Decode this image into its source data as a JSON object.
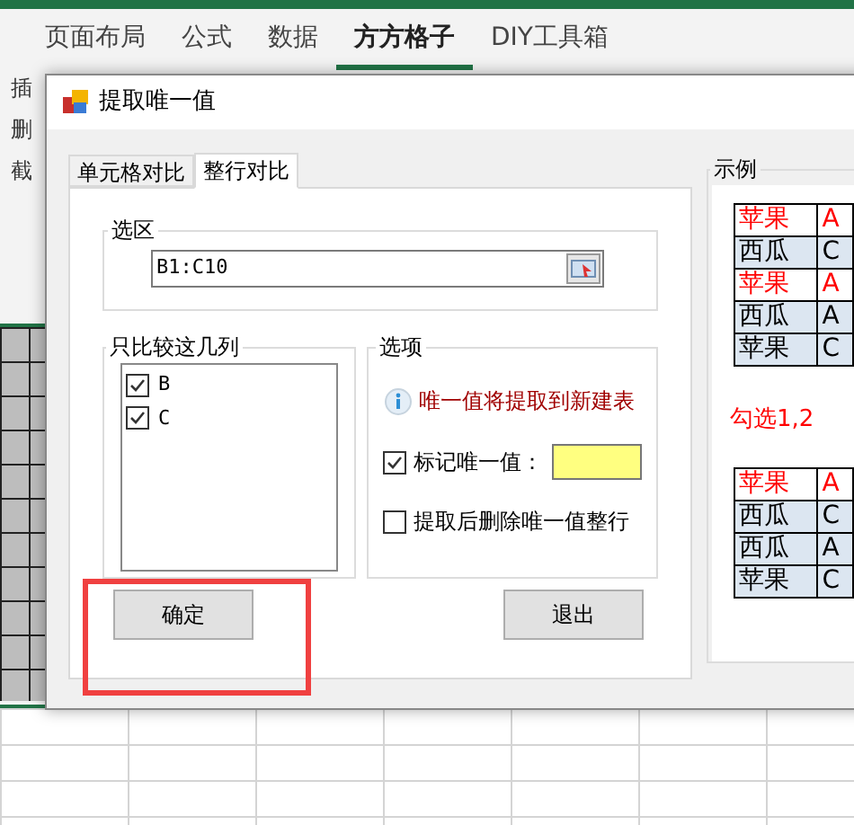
{
  "ribbon": {
    "tabs": [
      {
        "label": "页面布局",
        "selected": false
      },
      {
        "label": "公式",
        "selected": false
      },
      {
        "label": "数据",
        "selected": false
      },
      {
        "label": "方方格子",
        "selected": true
      },
      {
        "label": "DIY工具箱",
        "selected": false
      }
    ],
    "commands": [
      "插",
      "删",
      "截"
    ]
  },
  "dialog": {
    "title": "提取唯一值",
    "tabs": [
      {
        "label": "单元格对比",
        "selected": false
      },
      {
        "label": "整行对比",
        "selected": true
      }
    ],
    "range": {
      "label": "选区",
      "value": "B1:C10"
    },
    "columns": {
      "label": "只比较这几列",
      "items": [
        {
          "label": "B",
          "checked": true
        },
        {
          "label": "C",
          "checked": true
        }
      ]
    },
    "options": {
      "label": "选项",
      "info": "唯一值将提取到新建表",
      "items": [
        {
          "kind": "swatch",
          "label": "标记唯一值：",
          "checked": true,
          "color": "#ffff80"
        },
        {
          "kind": "plain",
          "label": "提取后删除唯一值整行",
          "checked": false
        }
      ]
    },
    "ok_button": "确定",
    "exit_button": "退出",
    "example": {
      "label": "示例",
      "before": [
        {
          "cells": [
            "苹果",
            "A"
          ],
          "highlight": true
        },
        {
          "cells": [
            "西瓜",
            "C"
          ],
          "highlight": false
        },
        {
          "cells": [
            "苹果",
            "A"
          ],
          "highlight": true
        },
        {
          "cells": [
            "西瓜",
            "A"
          ],
          "highlight": false
        },
        {
          "cells": [
            "苹果",
            "C"
          ],
          "highlight": false
        }
      ],
      "note": "勾选1,2",
      "after": [
        {
          "cells": [
            "苹果",
            "A"
          ],
          "highlight": true
        },
        {
          "cells": [
            "西瓜",
            "C"
          ],
          "highlight": false
        },
        {
          "cells": [
            "西瓜",
            "A"
          ],
          "highlight": false
        },
        {
          "cells": [
            "苹果",
            "C"
          ],
          "highlight": false
        }
      ]
    }
  }
}
